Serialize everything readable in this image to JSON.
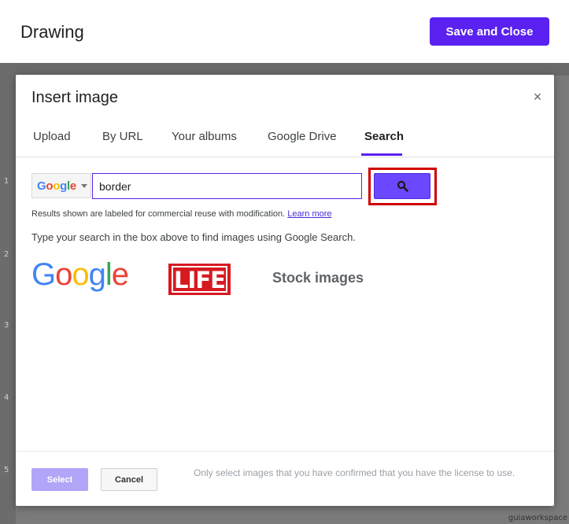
{
  "editor": {
    "title": "Drawing",
    "save_close_label": "Save and Close",
    "ruler_marks": [
      "1",
      "2",
      "3",
      "4",
      "5"
    ],
    "watermark": "guiaworkspace"
  },
  "dialog": {
    "title": "Insert image",
    "close_icon": "×",
    "tabs": [
      {
        "label": "Upload"
      },
      {
        "label": "By URL"
      },
      {
        "label": "Your albums"
      },
      {
        "label": "Google Drive"
      },
      {
        "label": "Search",
        "active": true
      }
    ],
    "search": {
      "engine": "Google",
      "query": "border",
      "button_icon": "search-icon"
    },
    "license_note": "Results shown are labeled for commercial reuse with modification.",
    "learn_more": "Learn more",
    "instructions": "Type your search in the box above to find images using Google Search.",
    "sources": {
      "google": "Google",
      "life": "LIFE",
      "stock": "Stock images"
    },
    "footer": {
      "select_label": "Select",
      "cancel_label": "Cancel",
      "note": "Only select images that you have confirmed that you have the license to use."
    }
  },
  "colors": {
    "accent": "#5a21f0",
    "search_button": "#6b47ff",
    "highlight": "#d00000"
  }
}
